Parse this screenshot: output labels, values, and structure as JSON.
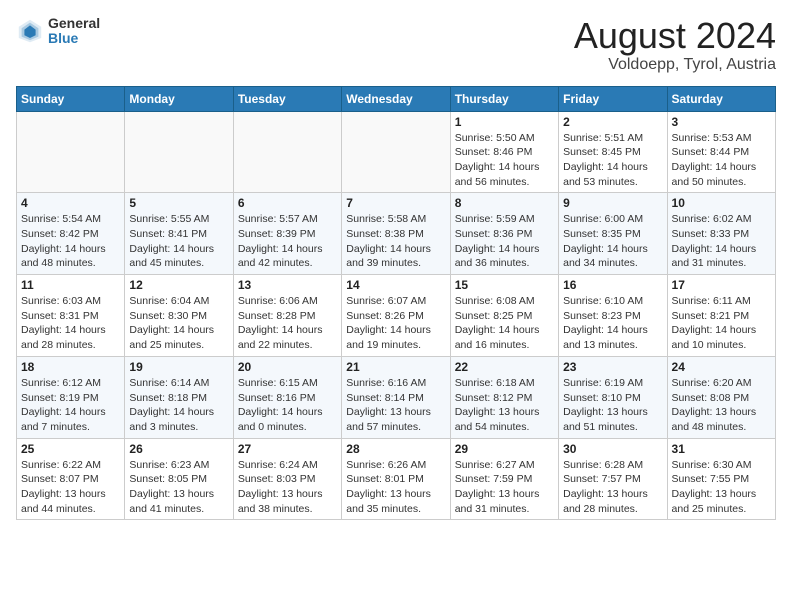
{
  "logo": {
    "line1": "General",
    "line2": "Blue"
  },
  "title": "August 2024",
  "subtitle": "Voldoepp, Tyrol, Austria",
  "days_of_week": [
    "Sunday",
    "Monday",
    "Tuesday",
    "Wednesday",
    "Thursday",
    "Friday",
    "Saturday"
  ],
  "weeks": [
    [
      {
        "day": "",
        "info": ""
      },
      {
        "day": "",
        "info": ""
      },
      {
        "day": "",
        "info": ""
      },
      {
        "day": "",
        "info": ""
      },
      {
        "day": "1",
        "info": "Sunrise: 5:50 AM\nSunset: 8:46 PM\nDaylight: 14 hours\nand 56 minutes."
      },
      {
        "day": "2",
        "info": "Sunrise: 5:51 AM\nSunset: 8:45 PM\nDaylight: 14 hours\nand 53 minutes."
      },
      {
        "day": "3",
        "info": "Sunrise: 5:53 AM\nSunset: 8:44 PM\nDaylight: 14 hours\nand 50 minutes."
      }
    ],
    [
      {
        "day": "4",
        "info": "Sunrise: 5:54 AM\nSunset: 8:42 PM\nDaylight: 14 hours\nand 48 minutes."
      },
      {
        "day": "5",
        "info": "Sunrise: 5:55 AM\nSunset: 8:41 PM\nDaylight: 14 hours\nand 45 minutes."
      },
      {
        "day": "6",
        "info": "Sunrise: 5:57 AM\nSunset: 8:39 PM\nDaylight: 14 hours\nand 42 minutes."
      },
      {
        "day": "7",
        "info": "Sunrise: 5:58 AM\nSunset: 8:38 PM\nDaylight: 14 hours\nand 39 minutes."
      },
      {
        "day": "8",
        "info": "Sunrise: 5:59 AM\nSunset: 8:36 PM\nDaylight: 14 hours\nand 36 minutes."
      },
      {
        "day": "9",
        "info": "Sunrise: 6:00 AM\nSunset: 8:35 PM\nDaylight: 14 hours\nand 34 minutes."
      },
      {
        "day": "10",
        "info": "Sunrise: 6:02 AM\nSunset: 8:33 PM\nDaylight: 14 hours\nand 31 minutes."
      }
    ],
    [
      {
        "day": "11",
        "info": "Sunrise: 6:03 AM\nSunset: 8:31 PM\nDaylight: 14 hours\nand 28 minutes."
      },
      {
        "day": "12",
        "info": "Sunrise: 6:04 AM\nSunset: 8:30 PM\nDaylight: 14 hours\nand 25 minutes."
      },
      {
        "day": "13",
        "info": "Sunrise: 6:06 AM\nSunset: 8:28 PM\nDaylight: 14 hours\nand 22 minutes."
      },
      {
        "day": "14",
        "info": "Sunrise: 6:07 AM\nSunset: 8:26 PM\nDaylight: 14 hours\nand 19 minutes."
      },
      {
        "day": "15",
        "info": "Sunrise: 6:08 AM\nSunset: 8:25 PM\nDaylight: 14 hours\nand 16 minutes."
      },
      {
        "day": "16",
        "info": "Sunrise: 6:10 AM\nSunset: 8:23 PM\nDaylight: 14 hours\nand 13 minutes."
      },
      {
        "day": "17",
        "info": "Sunrise: 6:11 AM\nSunset: 8:21 PM\nDaylight: 14 hours\nand 10 minutes."
      }
    ],
    [
      {
        "day": "18",
        "info": "Sunrise: 6:12 AM\nSunset: 8:19 PM\nDaylight: 14 hours\nand 7 minutes."
      },
      {
        "day": "19",
        "info": "Sunrise: 6:14 AM\nSunset: 8:18 PM\nDaylight: 14 hours\nand 3 minutes."
      },
      {
        "day": "20",
        "info": "Sunrise: 6:15 AM\nSunset: 8:16 PM\nDaylight: 14 hours\nand 0 minutes."
      },
      {
        "day": "21",
        "info": "Sunrise: 6:16 AM\nSunset: 8:14 PM\nDaylight: 13 hours\nand 57 minutes."
      },
      {
        "day": "22",
        "info": "Sunrise: 6:18 AM\nSunset: 8:12 PM\nDaylight: 13 hours\nand 54 minutes."
      },
      {
        "day": "23",
        "info": "Sunrise: 6:19 AM\nSunset: 8:10 PM\nDaylight: 13 hours\nand 51 minutes."
      },
      {
        "day": "24",
        "info": "Sunrise: 6:20 AM\nSunset: 8:08 PM\nDaylight: 13 hours\nand 48 minutes."
      }
    ],
    [
      {
        "day": "25",
        "info": "Sunrise: 6:22 AM\nSunset: 8:07 PM\nDaylight: 13 hours\nand 44 minutes."
      },
      {
        "day": "26",
        "info": "Sunrise: 6:23 AM\nSunset: 8:05 PM\nDaylight: 13 hours\nand 41 minutes."
      },
      {
        "day": "27",
        "info": "Sunrise: 6:24 AM\nSunset: 8:03 PM\nDaylight: 13 hours\nand 38 minutes."
      },
      {
        "day": "28",
        "info": "Sunrise: 6:26 AM\nSunset: 8:01 PM\nDaylight: 13 hours\nand 35 minutes."
      },
      {
        "day": "29",
        "info": "Sunrise: 6:27 AM\nSunset: 7:59 PM\nDaylight: 13 hours\nand 31 minutes."
      },
      {
        "day": "30",
        "info": "Sunrise: 6:28 AM\nSunset: 7:57 PM\nDaylight: 13 hours\nand 28 minutes."
      },
      {
        "day": "31",
        "info": "Sunrise: 6:30 AM\nSunset: 7:55 PM\nDaylight: 13 hours\nand 25 minutes."
      }
    ]
  ]
}
